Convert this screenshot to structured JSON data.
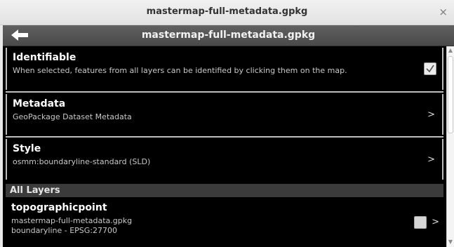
{
  "window": {
    "title": "mastermap-full-metadata.gpkg",
    "close_glyph": "×"
  },
  "actionbar": {
    "title": "mastermap-full-metadata.gpkg",
    "back_icon": "back-arrow-icon"
  },
  "identifiable": {
    "label": "Identifiable",
    "description": "When selected, features from all layers can be identified by clicking them on the map.",
    "checked": true,
    "check_glyph": "✓"
  },
  "metadata": {
    "label": "Metadata",
    "subtitle": "GeoPackage Dataset Metadata",
    "chevron": ">"
  },
  "style": {
    "label": "Style",
    "subtitle": "osmm:boundaryline-standard (SLD)",
    "chevron": ">"
  },
  "layers_section": {
    "title": "All Layers"
  },
  "layers": [
    {
      "name": "topographicpoint",
      "source": "mastermap-full-metadata.gpkg",
      "detail": "boundaryline - EPSG:27700",
      "checked": false,
      "chevron": ">"
    }
  ],
  "colors": {
    "accent": "#000000",
    "section_bg": "#3b3b3b",
    "actionbar_bg": "#4f4f4f"
  }
}
